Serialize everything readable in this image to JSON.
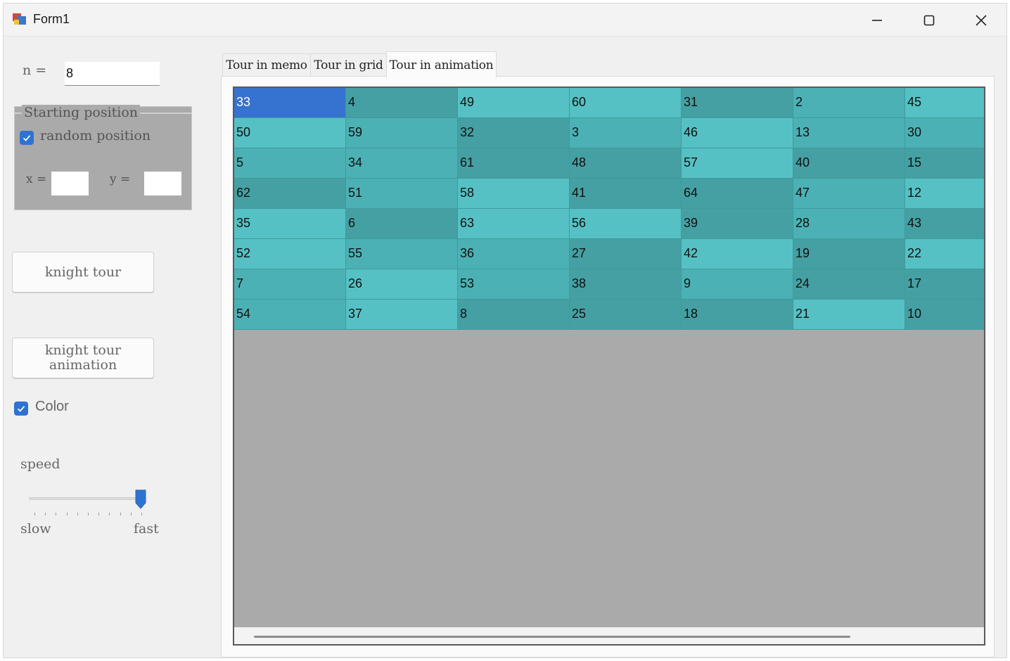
{
  "window": {
    "title": "Form1"
  },
  "left": {
    "n_label": "n =",
    "n_value": "8",
    "group_title": "Starting position",
    "random_label": "random position",
    "random_checked": true,
    "x_label": "x =",
    "y_label": "y =",
    "x_value": "",
    "y_value": "",
    "knight_tour_button": "knight tour",
    "animation_button_line1": "knight tour",
    "animation_button_line2": "animation",
    "color_label": "Color",
    "color_checked": true,
    "speed_label": "speed",
    "slow_label": "slow",
    "fast_label": "fast",
    "speed_level": 1.0
  },
  "tabs": [
    "Tour in memo",
    "Tour in grid",
    "Tour in animation"
  ],
  "active_tab": "Tour in animation",
  "grid": {
    "visible_columns": 7,
    "rows": [
      [
        "33",
        "4",
        "49",
        "60",
        "31",
        "2",
        "45"
      ],
      [
        "50",
        "59",
        "32",
        "3",
        "46",
        "13",
        "30"
      ],
      [
        "5",
        "34",
        "61",
        "48",
        "57",
        "40",
        "15"
      ],
      [
        "62",
        "51",
        "58",
        "41",
        "64",
        "47",
        "12"
      ],
      [
        "35",
        "6",
        "63",
        "56",
        "39",
        "28",
        "43"
      ],
      [
        "52",
        "55",
        "36",
        "27",
        "42",
        "19",
        "22"
      ],
      [
        "7",
        "26",
        "53",
        "38",
        "9",
        "24",
        "17"
      ],
      [
        "54",
        "37",
        "8",
        "25",
        "18",
        "21",
        "10"
      ]
    ],
    "selected_cell": "33"
  },
  "colors": {
    "cell_light": "#56c1c4",
    "cell_medium": "#4cb1b4",
    "cell_dark": "#45a0a3",
    "selected": "#3672cf",
    "accent": "#2e73d1"
  }
}
